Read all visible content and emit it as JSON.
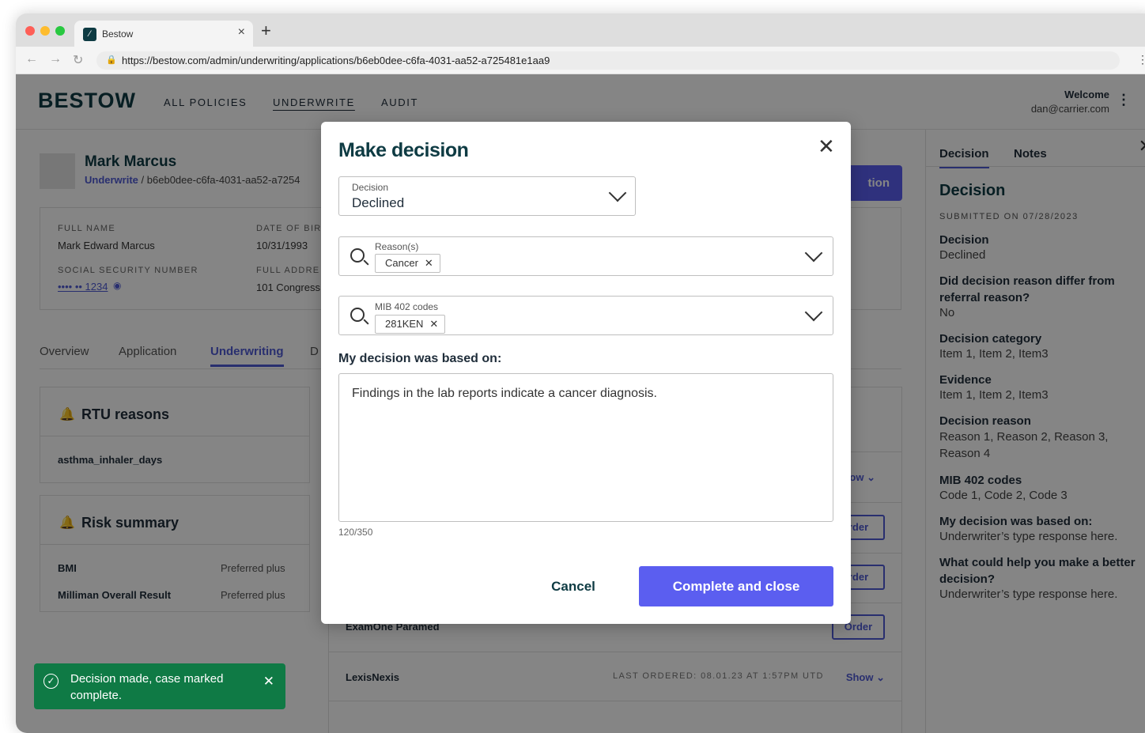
{
  "browser": {
    "tab_title": "Bestow",
    "url": "https://bestow.com/admin/underwriting/applications/b6eb0dee-c6fa-4031-aa52-a725481e1aa9"
  },
  "header": {
    "logo": "BESTOW",
    "nav": [
      "ALL POLICIES",
      "UNDERWRITE",
      "AUDIT"
    ],
    "active_nav": "UNDERWRITE",
    "welcome": "Welcome",
    "email": "dan@carrier.com"
  },
  "person": {
    "name": "Mark Marcus",
    "breadcrumb_link": "Underwrite",
    "breadcrumb_sep": "/",
    "breadcrumb_id": "b6eb0dee-c6fa-4031-aa52-a7254",
    "cta_partial": "tion"
  },
  "info": {
    "full_name_label": "FULL NAME",
    "full_name": "Mark Edward Marcus",
    "dob_label": "DATE OF BIR",
    "dob": "10/31/1993",
    "ssn_label": "SOCIAL SECURITY NUMBER",
    "ssn": "•••• •• 1234",
    "address_label": "FULL ADDRE",
    "address": "101 Congress"
  },
  "subtabs": [
    "Overview",
    "Application",
    "Underwriting",
    "D"
  ],
  "rtu": {
    "title": "RTU reasons",
    "item": "asthma_inhaler_days"
  },
  "risk": {
    "title": "Risk summary",
    "rows": [
      {
        "label": "BMI",
        "value": "Preferred plus"
      },
      {
        "label": "Milliman Overall Result",
        "value": "Preferred plus"
      }
    ]
  },
  "providers": {
    "show_label": "Show",
    "order_label": "Order",
    "partial_show": "how",
    "partial_order": "rder",
    "exam_one": "ExamOne Paramed",
    "lexis": "LexisNexis",
    "lexis_last_ordered": "LAST ORDERED: 08.01.23 AT 1:57PM UTD"
  },
  "toast": {
    "message": "Decision made, case marked complete."
  },
  "right_panel": {
    "tabs": [
      "Decision",
      "Notes"
    ],
    "heading": "Decision",
    "submitted": "SUBMITTED ON 07/28/2023",
    "items": [
      {
        "q": "Decision",
        "a": "Declined"
      },
      {
        "q": "Did decision reason differ from referral reason?",
        "a": "No"
      },
      {
        "q": "Decision category",
        "a": "Item 1, Item 2, Item3"
      },
      {
        "q": "Evidence",
        "a": "Item 1, Item 2, Item3"
      },
      {
        "q": "Decision reason",
        "a": "Reason 1, Reason 2, Reason 3, Reason 4"
      },
      {
        "q": "MIB 402 codes",
        "a": "Code 1, Code 2, Code 3"
      },
      {
        "q": "My decision was based on:",
        "a": "Underwriter’s type response here."
      },
      {
        "q": "What could help you make a better decision?",
        "a": "Underwriter’s type response here."
      }
    ]
  },
  "modal": {
    "title": "Make decision",
    "decision_label": "Decision",
    "decision_value": "Declined",
    "reasons_label": "Reason(s)",
    "reasons_chip": "Cancer",
    "mib_label": "MIB 402 codes",
    "mib_chip": "281KEN",
    "based_label": "My decision was based on:",
    "based_text": "Findings in the lab reports indicate a cancer diagnosis.",
    "counter": "120/350",
    "cancel": "Cancel",
    "complete": "Complete and close"
  }
}
